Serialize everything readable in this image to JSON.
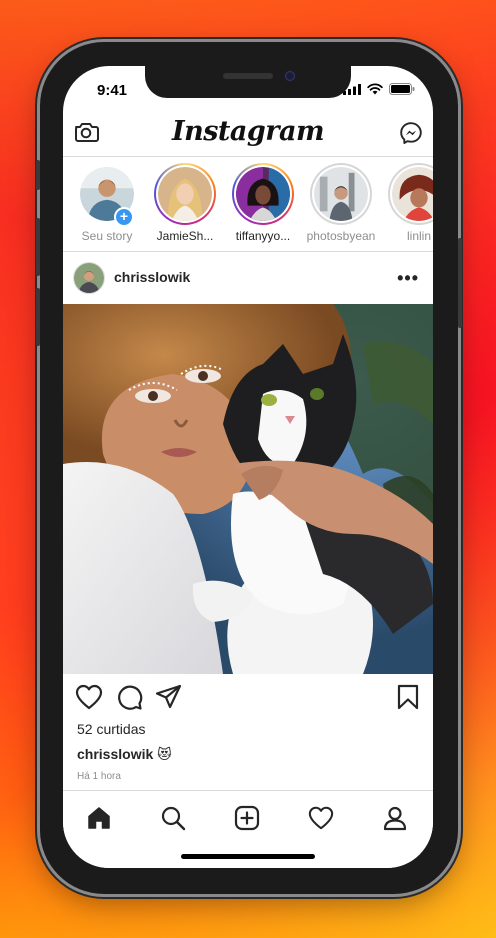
{
  "status": {
    "time": "9:41"
  },
  "app": {
    "logo": "Instagram"
  },
  "colors": {
    "accent": "#3897f0",
    "story_ring": [
      "#feda75",
      "#fa7e1e",
      "#d62976",
      "#962fbf",
      "#4f5bd5"
    ]
  },
  "stories": [
    {
      "label": "Seu story",
      "own": true
    },
    {
      "label": "JamieSh...",
      "own": false
    },
    {
      "label": "tiffanyyo...",
      "own": false
    },
    {
      "label": "photosbyean",
      "own": false
    },
    {
      "label": "linlin",
      "own": false
    }
  ],
  "post": {
    "username": "chrisslowik",
    "more": "•••",
    "likes": "52 curtidas",
    "caption_user": "chrisslowik",
    "caption_emoji": "😻",
    "time_ago": "Há 1 hora"
  },
  "icons": {
    "nav": [
      "camera-icon",
      "messenger-icon"
    ],
    "actions": [
      "heart-icon",
      "comment-icon",
      "share-icon",
      "bookmark-icon"
    ],
    "tabs": [
      "home-icon",
      "search-icon",
      "new-post-icon",
      "activity-icon",
      "profile-icon"
    ]
  }
}
